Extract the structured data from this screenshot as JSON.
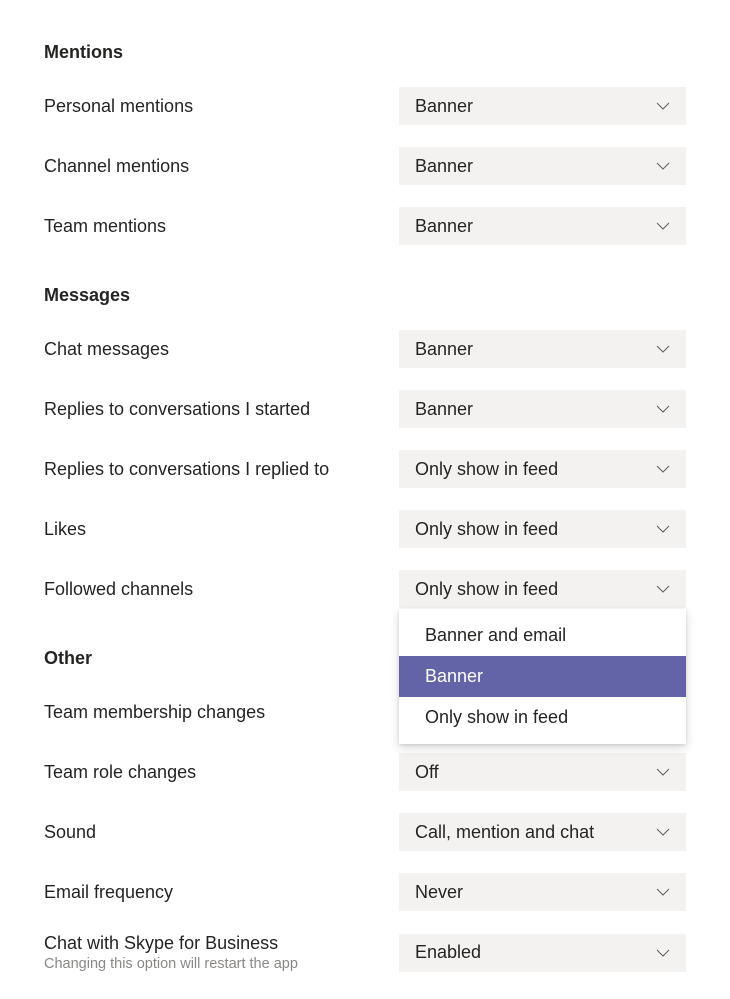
{
  "sections": {
    "mentions": {
      "heading": "Mentions",
      "personal": {
        "label": "Personal mentions",
        "value": "Banner"
      },
      "channel": {
        "label": "Channel mentions",
        "value": "Banner"
      },
      "team": {
        "label": "Team mentions",
        "value": "Banner"
      }
    },
    "messages": {
      "heading": "Messages",
      "chat": {
        "label": "Chat messages",
        "value": "Banner"
      },
      "replies_started": {
        "label": "Replies to conversations I started",
        "value": "Banner"
      },
      "replies_replied": {
        "label": "Replies to conversations I replied to",
        "value": "Only show in feed"
      },
      "likes": {
        "label": "Likes",
        "value": "Only show in feed"
      },
      "followed": {
        "label": "Followed channels",
        "value": "Only show in feed",
        "open": true,
        "options": [
          "Banner and email",
          "Banner",
          "Only show in feed"
        ],
        "selected_index": 1
      }
    },
    "other": {
      "heading": "Other",
      "membership": {
        "label": "Team membership changes",
        "value": ""
      },
      "role": {
        "label": "Team role changes",
        "value": "Off"
      },
      "sound": {
        "label": "Sound",
        "value": "Call, mention and chat"
      },
      "email": {
        "label": "Email frequency",
        "value": "Never"
      },
      "skype": {
        "label": "Chat with Skype for Business",
        "value": "Enabled",
        "sub": "Changing this option will restart the app"
      }
    }
  }
}
